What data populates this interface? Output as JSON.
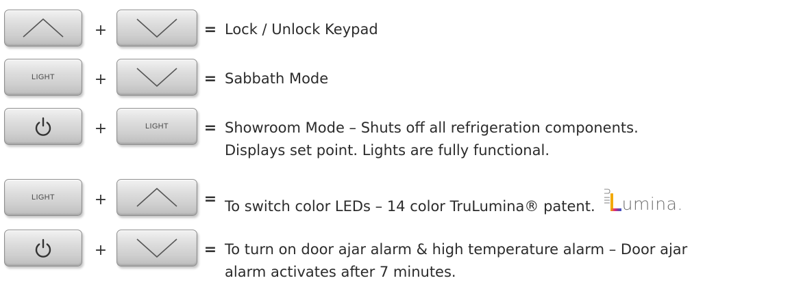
{
  "rows": [
    {
      "key1": {
        "icon": "chevron-up-icon"
      },
      "plus": "+",
      "key2": {
        "icon": "chevron-down-icon"
      },
      "eq": "=",
      "desc": [
        "Lock / Unlock Keypad"
      ]
    },
    {
      "key1": {
        "label": "LIGHT"
      },
      "plus": "+",
      "key2": {
        "icon": "chevron-down-icon"
      },
      "eq": "=",
      "desc": [
        "Sabbath Mode"
      ]
    },
    {
      "key1": {
        "icon": "power-icon"
      },
      "plus": "+",
      "key2": {
        "label": "LIGHT"
      },
      "eq": "=",
      "desc": [
        "Showroom Mode – Shuts off all refrigeration components.",
        "Displays set point. Lights are fully functional."
      ]
    },
    {
      "key1": {
        "label": "LIGHT"
      },
      "plus": "+",
      "key2": {
        "icon": "chevron-up-icon"
      },
      "eq": "=",
      "desc": [
        "To switch color LEDs – 14 color TruLumina® patent."
      ]
    },
    {
      "key1": {
        "icon": "power-icon"
      },
      "plus": "+",
      "key2": {
        "icon": "chevron-down-icon"
      },
      "eq": "=",
      "desc": [
        "To turn on door ajar alarm & high temperature alarm – Door ajar",
        "alarm activates after 7 minutes."
      ]
    }
  ],
  "logo": {
    "text": "umina.",
    "gradient_colors": [
      "#f2a900",
      "#e2277f",
      "#7b3fa0",
      "#3a55c8"
    ]
  }
}
